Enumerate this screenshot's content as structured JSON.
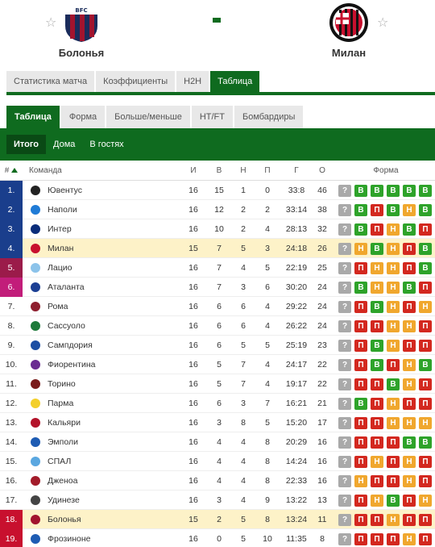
{
  "match": {
    "home": {
      "name": "Болонья",
      "logo_text": "BFC\n1909",
      "colors": [
        "#a2142e",
        "#1a2c5b"
      ]
    },
    "away": {
      "name": "Милан",
      "logo_text": "ACM\n1899",
      "colors": [
        "#c8102e",
        "#111111"
      ]
    },
    "separator": "-"
  },
  "tabs_main": [
    "Статистика матча",
    "Коэффициенты",
    "H2H",
    "Таблица"
  ],
  "tabs_main_active": 3,
  "tabs_sub": [
    "Таблица",
    "Форма",
    "Больше/меньше",
    "HT/FT",
    "Бомбардиры"
  ],
  "tabs_sub_active": 0,
  "filters": [
    "Итого",
    "Дома",
    "В гостях"
  ],
  "filters_active": 0,
  "colors": {
    "accent": "#0f6b1f",
    "highlight": "#fdf2c8",
    "cl": "#1a3e8c",
    "el": "#9b1b4a",
    "rel": "#c8102e"
  },
  "headers": {
    "pos": "#",
    "team": "Команда",
    "i": "И",
    "w": "В",
    "d": "Н",
    "l": "П",
    "g": "Г",
    "pts": "О",
    "form": "Форма"
  },
  "rows": [
    {
      "pos": "1.",
      "team": "Ювентус",
      "i": "16",
      "w": "15",
      "d": "1",
      "l": "0",
      "g": "33:8",
      "pts": "46",
      "form": [
        "?",
        "В",
        "В",
        "В",
        "В",
        "В"
      ],
      "zone": "cl",
      "logo": "#222222"
    },
    {
      "pos": "2.",
      "team": "Наполи",
      "i": "16",
      "w": "12",
      "d": "2",
      "l": "2",
      "g": "33:14",
      "pts": "38",
      "form": [
        "?",
        "В",
        "П",
        "В",
        "Н",
        "В"
      ],
      "zone": "cl",
      "logo": "#1f7bd6"
    },
    {
      "pos": "3.",
      "team": "Интер",
      "i": "16",
      "w": "10",
      "d": "2",
      "l": "4",
      "g": "28:13",
      "pts": "32",
      "form": [
        "?",
        "В",
        "П",
        "Н",
        "В",
        "П"
      ],
      "zone": "cl",
      "logo": "#0b2d7a"
    },
    {
      "pos": "4.",
      "team": "Милан",
      "i": "15",
      "w": "7",
      "d": "5",
      "l": "3",
      "g": "24:18",
      "pts": "26",
      "form": [
        "?",
        "Н",
        "В",
        "Н",
        "П",
        "В"
      ],
      "zone": "cl",
      "logo": "#c8102e",
      "hl": true
    },
    {
      "pos": "5.",
      "team": "Лацио",
      "i": "16",
      "w": "7",
      "d": "4",
      "l": "5",
      "g": "22:19",
      "pts": "25",
      "form": [
        "?",
        "П",
        "Н",
        "Н",
        "П",
        "В"
      ],
      "zone": "el",
      "logo": "#8cc3ea"
    },
    {
      "pos": "6.",
      "team": "Аталанта",
      "i": "16",
      "w": "7",
      "d": "3",
      "l": "6",
      "g": "30:20",
      "pts": "24",
      "form": [
        "?",
        "В",
        "Н",
        "Н",
        "В",
        "П"
      ],
      "zone": "el2",
      "logo": "#1c3f94"
    },
    {
      "pos": "7.",
      "team": "Рома",
      "i": "16",
      "w": "6",
      "d": "6",
      "l": "4",
      "g": "29:22",
      "pts": "24",
      "form": [
        "?",
        "П",
        "В",
        "Н",
        "П",
        "Н"
      ],
      "zone": "",
      "logo": "#8e1f2f"
    },
    {
      "pos": "8.",
      "team": "Сассуоло",
      "i": "16",
      "w": "6",
      "d": "6",
      "l": "4",
      "g": "26:22",
      "pts": "24",
      "form": [
        "?",
        "П",
        "П",
        "Н",
        "Н",
        "П"
      ],
      "zone": "",
      "logo": "#1e7a3a"
    },
    {
      "pos": "9.",
      "team": "Сампдория",
      "i": "16",
      "w": "6",
      "d": "5",
      "l": "5",
      "g": "25:19",
      "pts": "23",
      "form": [
        "?",
        "П",
        "В",
        "Н",
        "П",
        "П"
      ],
      "zone": "",
      "logo": "#1d4fa3"
    },
    {
      "pos": "10.",
      "team": "Фиорентина",
      "i": "16",
      "w": "5",
      "d": "7",
      "l": "4",
      "g": "24:17",
      "pts": "22",
      "form": [
        "?",
        "П",
        "В",
        "П",
        "Н",
        "В"
      ],
      "zone": "",
      "logo": "#6a2c91"
    },
    {
      "pos": "11.",
      "team": "Торино",
      "i": "16",
      "w": "5",
      "d": "7",
      "l": "4",
      "g": "19:17",
      "pts": "22",
      "form": [
        "?",
        "П",
        "П",
        "В",
        "Н",
        "П"
      ],
      "zone": "",
      "logo": "#7a1c1c"
    },
    {
      "pos": "12.",
      "team": "Парма",
      "i": "16",
      "w": "6",
      "d": "3",
      "l": "7",
      "g": "16:21",
      "pts": "21",
      "form": [
        "?",
        "В",
        "П",
        "Н",
        "П",
        "П"
      ],
      "zone": "",
      "logo": "#f3cf2a"
    },
    {
      "pos": "13.",
      "team": "Кальяри",
      "i": "16",
      "w": "3",
      "d": "8",
      "l": "5",
      "g": "15:20",
      "pts": "17",
      "form": [
        "?",
        "П",
        "П",
        "Н",
        "Н",
        "Н"
      ],
      "zone": "",
      "logo": "#b3132a"
    },
    {
      "pos": "14.",
      "team": "Эмполи",
      "i": "16",
      "w": "4",
      "d": "4",
      "l": "8",
      "g": "20:29",
      "pts": "16",
      "form": [
        "?",
        "П",
        "П",
        "П",
        "В",
        "В"
      ],
      "zone": "",
      "logo": "#1e5cb3"
    },
    {
      "pos": "15.",
      "team": "СПАЛ",
      "i": "16",
      "w": "4",
      "d": "4",
      "l": "8",
      "g": "14:24",
      "pts": "16",
      "form": [
        "?",
        "П",
        "Н",
        "П",
        "Н",
        "П"
      ],
      "zone": "",
      "logo": "#5aa7e0"
    },
    {
      "pos": "16.",
      "team": "Дженоа",
      "i": "16",
      "w": "4",
      "d": "4",
      "l": "8",
      "g": "22:33",
      "pts": "16",
      "form": [
        "?",
        "Н",
        "П",
        "П",
        "Н",
        "П"
      ],
      "zone": "",
      "logo": "#a31c2a"
    },
    {
      "pos": "17.",
      "team": "Удинезе",
      "i": "16",
      "w": "3",
      "d": "4",
      "l": "9",
      "g": "13:22",
      "pts": "13",
      "form": [
        "?",
        "П",
        "Н",
        "В",
        "П",
        "Н"
      ],
      "zone": "",
      "logo": "#444444"
    },
    {
      "pos": "18.",
      "team": "Болонья",
      "i": "15",
      "w": "2",
      "d": "5",
      "l": "8",
      "g": "13:24",
      "pts": "11",
      "form": [
        "?",
        "П",
        "П",
        "Н",
        "П",
        "П"
      ],
      "zone": "rel",
      "logo": "#a2142e",
      "hl": true
    },
    {
      "pos": "19.",
      "team": "Фрозиноне",
      "i": "16",
      "w": "0",
      "d": "5",
      "l": "10",
      "g": "11:35",
      "pts": "8",
      "form": [
        "?",
        "П",
        "П",
        "П",
        "Н",
        "П"
      ],
      "zone": "rel",
      "logo": "#1e5cb3"
    }
  ]
}
